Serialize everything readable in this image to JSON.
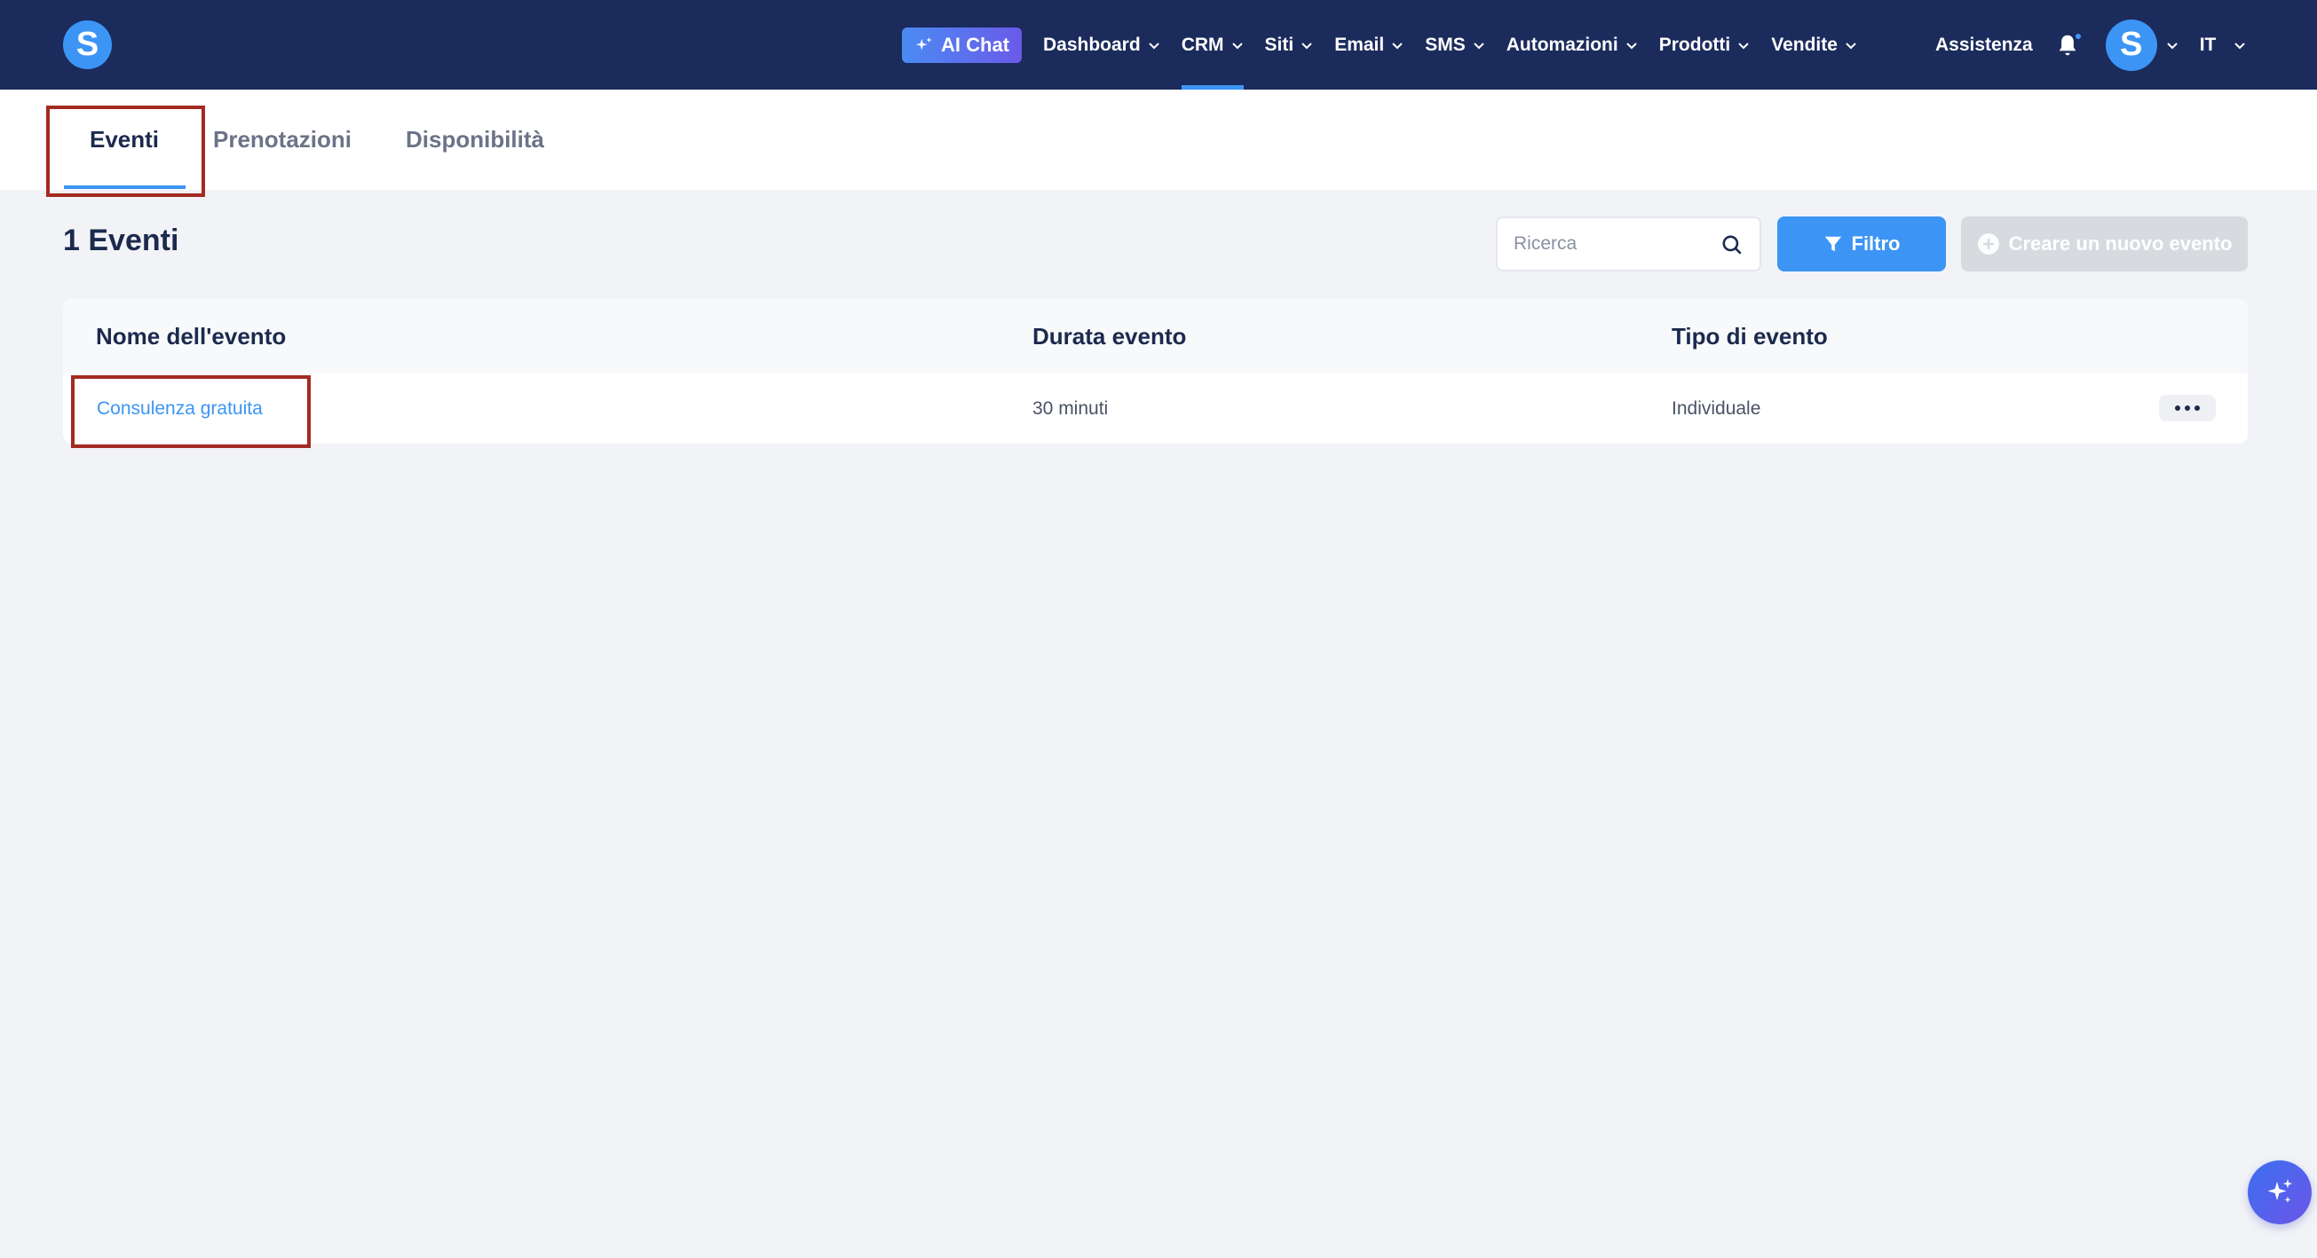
{
  "header": {
    "logo_letter": "S",
    "ai_chat_label": "AI Chat",
    "nav": [
      {
        "label": "Dashboard",
        "active": false
      },
      {
        "label": "CRM",
        "active": true
      },
      {
        "label": "Siti",
        "active": false
      },
      {
        "label": "Email",
        "active": false
      },
      {
        "label": "SMS",
        "active": false
      },
      {
        "label": "Automazioni",
        "active": false
      },
      {
        "label": "Prodotti",
        "active": false
      },
      {
        "label": "Vendite",
        "active": false
      }
    ],
    "assist_label": "Assistenza",
    "avatar_letter": "S",
    "lang": "IT"
  },
  "tabs": [
    {
      "label": "Eventi",
      "active": true
    },
    {
      "label": "Prenotazioni",
      "active": false
    },
    {
      "label": "Disponibilità",
      "active": false
    }
  ],
  "main": {
    "count_title": "1 Eventi",
    "search_placeholder": "Ricerca",
    "filter_label": "Filtro",
    "create_label": "Creare un nuovo evento"
  },
  "table": {
    "headers": [
      "Nome dell'evento",
      "Durata evento",
      "Tipo di evento"
    ],
    "rows": [
      {
        "name": "Consulenza gratuita",
        "duration": "30 minuti",
        "type": "Individuale"
      }
    ]
  },
  "colors": {
    "nav_bg": "#1b2b5c",
    "accent": "#3c95f5",
    "highlight": "#a32b21"
  }
}
